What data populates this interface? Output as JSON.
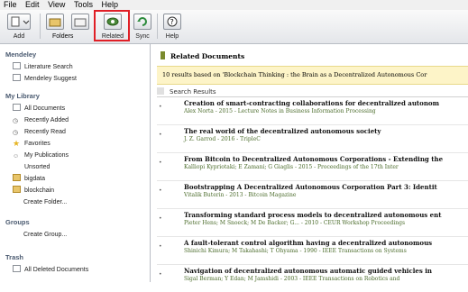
{
  "menu": [
    "File",
    "Edit",
    "View",
    "Tools",
    "Help"
  ],
  "toolbar": {
    "add": "Add",
    "folders": "Folders",
    "related": "Related",
    "sync": "Sync",
    "help": "Help"
  },
  "sidebar": {
    "mendeley_heading": "Mendeley",
    "literature_search": "Literature Search",
    "mendeley_suggest": "Mendeley Suggest",
    "library_heading": "My Library",
    "all_documents": "All Documents",
    "recently_added": "Recently Added",
    "recently_read": "Recently Read",
    "favorites": "Favorites",
    "my_publications": "My Publications",
    "unsorted": "Unsorted",
    "bigdata": "bigdata",
    "blockchain": "blockchain",
    "create_folder": "Create Folder...",
    "groups_heading": "Groups",
    "create_group": "Create Group...",
    "trash_heading": "Trash",
    "all_deleted": "All Deleted Documents"
  },
  "main": {
    "title": "Related Documents",
    "banner": "10 results based on 'Blockchain Thinking : the Brain as a Decentralized Autonomous Cor",
    "search_results": "Search Results",
    "results": [
      {
        "title": "Creation of smart-contracting collaborations for decentralized autonom",
        "meta": "Alex Norta - 2015 - Lecture Notes in Business Information Processing"
      },
      {
        "title": "The real world of the decentralized autonomous society",
        "meta": "J. Z. Garrod - 2016 - TripleC"
      },
      {
        "title": "From Bitcoin to Decentralized Autonomous Corporations - Extending the",
        "meta": "Kalliopi Kypriotaki; E Zamani; G Giaglis - 2015 - Proceedings of the 17th Inter"
      },
      {
        "title": "Bootstrapping A Decentralized Autonomous Corporation Part 3: Identit",
        "meta": "Vitalik Buterin - 2013 - Bitcoin Magazine"
      },
      {
        "title": "Transforming standard process models to decentralized autonomous ent",
        "meta": "Pieter Hens; M Snoeck; M De Backer; G... - 2010 - CEUR Workshop Proceedings"
      },
      {
        "title": "A fault-tolerant control algorithm having a decentralized autonomous",
        "meta": "Shinichi Kimura; M Takahashi; T Ohyama - 1990 - IEEE Transactions on Systems"
      },
      {
        "title": "Navigation of decentralized autonomous automatic guided vehicles in",
        "meta": "Sigal Berman; Y Edan; M Jamshidi - 2003 - IEEE Transactions on Robotics and"
      }
    ]
  },
  "colors": {
    "highlight": "#e01f26",
    "banner_bg": "#fdf4c8",
    "heading": "#4a5a70"
  }
}
